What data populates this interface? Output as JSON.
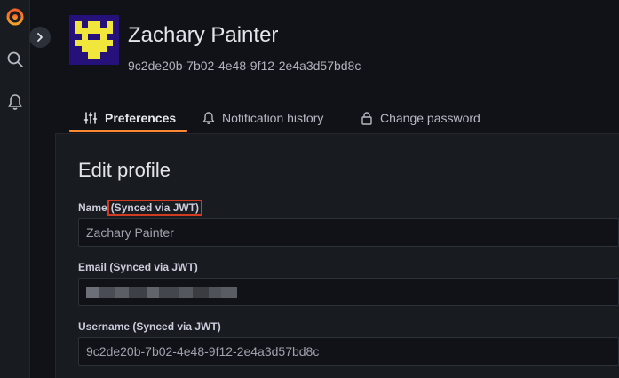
{
  "sidebar": {
    "icons": [
      "grafana-logo-icon",
      "search-icon",
      "bell-icon"
    ]
  },
  "profile": {
    "name": "Zachary Painter",
    "uid": "9c2de20b-7b02-4e48-9f12-2e4a3d57bd8c",
    "avatar_colors": {
      "background": "#26107a",
      "pattern": "#f0e63c"
    }
  },
  "tabs": [
    {
      "label": "Preferences",
      "icon": "sliders-icon",
      "active": true
    },
    {
      "label": "Notification history",
      "icon": "bell-icon",
      "active": false
    },
    {
      "label": "Change password",
      "icon": "lock-icon",
      "active": false
    }
  ],
  "edit_profile": {
    "title": "Edit profile",
    "name_label": "Name",
    "name_sync": "(Synced via JWT)",
    "name_value": "Zachary Painter",
    "email_label": "Email (Synced via JWT)",
    "username_label": "Username (Synced via JWT)",
    "username_value": "9c2de20b-7b02-4e48-9f12-2e4a3d57bd8c"
  },
  "colors": {
    "accent": "#ff8833",
    "highlight_border": "#d03c22",
    "background": "#111217",
    "panel": "#181b1f"
  }
}
